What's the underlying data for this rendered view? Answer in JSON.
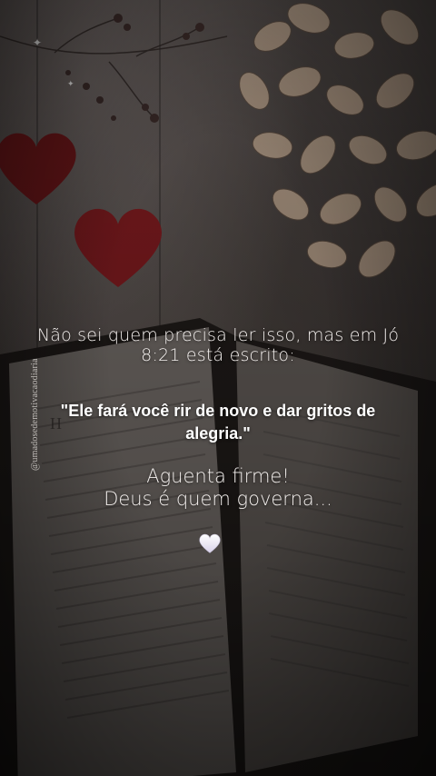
{
  "post": {
    "intro": "Não sei quem precisa ler isso, mas em Jó 8:21 está escrito:",
    "quote": "\"Ele fará você rir de novo e dar gritos de alegria.\"",
    "closing_line1": "Aguenta firme!",
    "closing_line2": "Deus é quem governa...",
    "emoji": "white-heart-icon",
    "watermark": "@umadosedemotivacaodiaria"
  },
  "colors": {
    "text": "#f4f0ee",
    "quote": "#ffffff",
    "heart_red": "#7a1a1e",
    "heart_white": "#ece8f5"
  }
}
